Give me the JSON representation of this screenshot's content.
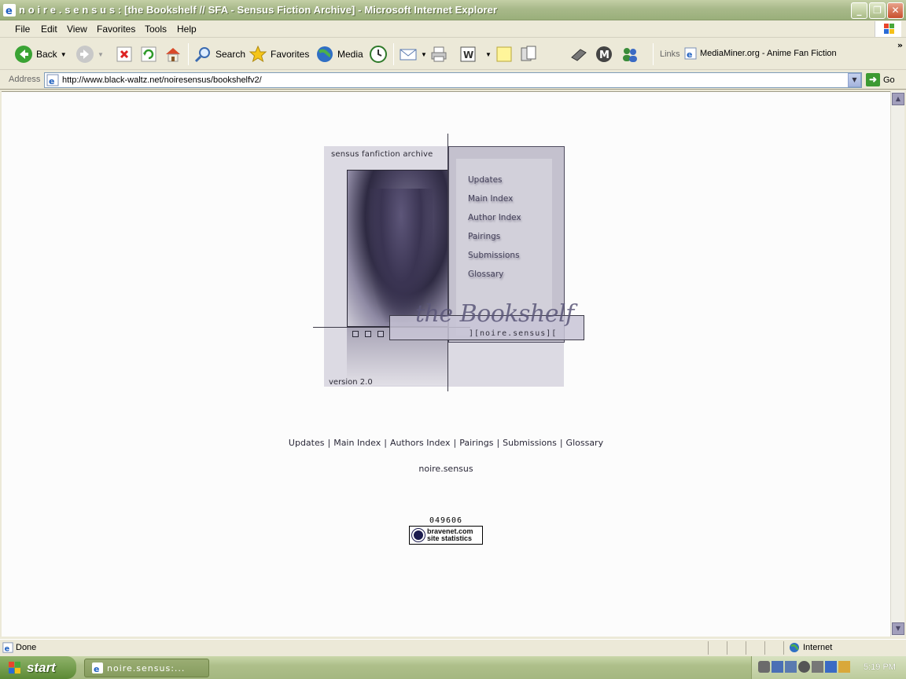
{
  "window": {
    "title": "n o i r e . s e n s u s : [the Bookshelf // SFA - Sensus Fiction Archive] - Microsoft Internet Explorer"
  },
  "menu": {
    "items": [
      "File",
      "Edit",
      "View",
      "Favorites",
      "Tools",
      "Help"
    ]
  },
  "toolbar": {
    "back": "Back",
    "search": "Search",
    "favorites": "Favorites",
    "media": "Media",
    "links_label": "Links",
    "link_item": "MediaMiner.org - Anime Fan Fiction"
  },
  "address": {
    "label": "Address",
    "url": "http://www.black-waltz.net/noiresensus/bookshelfv2/",
    "go": "Go"
  },
  "banner": {
    "top_label": "sensus fanfiction archive",
    "bottom_label": "version 2.0",
    "nav": [
      "Updates",
      "Main Index",
      "Author Index",
      "Pairings",
      "Submissions",
      "Glossary"
    ],
    "title_script": "the Bookshelf",
    "title_sub": "][noire.sensus]["
  },
  "text_nav": [
    "Updates",
    "Main Index",
    "Authors Index",
    "Pairings",
    "Submissions",
    "Glossary"
  ],
  "site_name": "noire.sensus",
  "counter": "049606",
  "bravenet": {
    "line1": "bravenet.com",
    "line2": "site statistics"
  },
  "status": {
    "text": "Done",
    "zone": "Internet"
  },
  "taskbar": {
    "start": "start",
    "task_item": "noire.sensus:...",
    "clock": "5:19 PM"
  },
  "colors": {
    "titlebar": "#a8b98a",
    "panel": "#c4c1ce",
    "text_dark": "#2a2838"
  }
}
